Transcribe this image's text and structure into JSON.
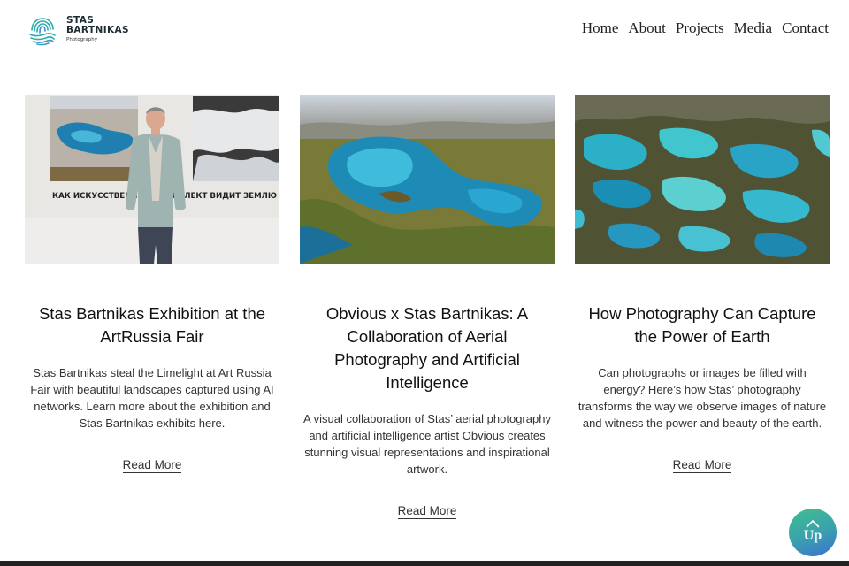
{
  "brand": {
    "name_line1": "STAS",
    "name_line2": "BARTNIKAS",
    "tagline": "Photography",
    "logo_icon": "fingerprint-icon"
  },
  "nav": {
    "items": [
      {
        "label": "Home"
      },
      {
        "label": "About"
      },
      {
        "label": "Projects"
      },
      {
        "label": "Media"
      },
      {
        "label": "Contact"
      }
    ]
  },
  "cards": [
    {
      "image": "exhibition-photo",
      "image_caption": "КАК ИСКУССТВЕННЫЙ ИНТЕЛЛЕКТ ВИДИТ ЗЕМЛЮ",
      "title": "Stas Bartnikas Exhibition at the ArtRussia Fair",
      "text": "Stas Bartnikas steal the Limelight at Art Russia Fair with beautiful landscapes captured using AI networks. Learn more about the exhibition and Stas Bartnikas exhibits here.",
      "read_more": "Read More"
    },
    {
      "image": "aerial-lake-photo",
      "title": "Obvious x Stas Bartnikas: A Collaboration of Aerial Photography and Artificial Intelligence",
      "text": "A visual collaboration of Stas’ aerial photography and artificial intelligence artist Obvious creates stunning visual representations and inspirational artwork.",
      "read_more": "Read More"
    },
    {
      "image": "aerial-lakes-photo",
      "title": "How Photography Can Capture the Power of Earth",
      "text": "Can photographs or images be filled with energy? Here’s how Stas’ photography transforms the way we observe images of nature and witness the power and beauty of the earth.",
      "read_more": "Read More"
    }
  ],
  "up_button": {
    "label": "Up",
    "icon": "chevron-up-icon"
  },
  "colors": {
    "up_gradient_start": "#3fc08c",
    "up_gradient_end": "#3b6fd0",
    "footer": "#222222"
  }
}
